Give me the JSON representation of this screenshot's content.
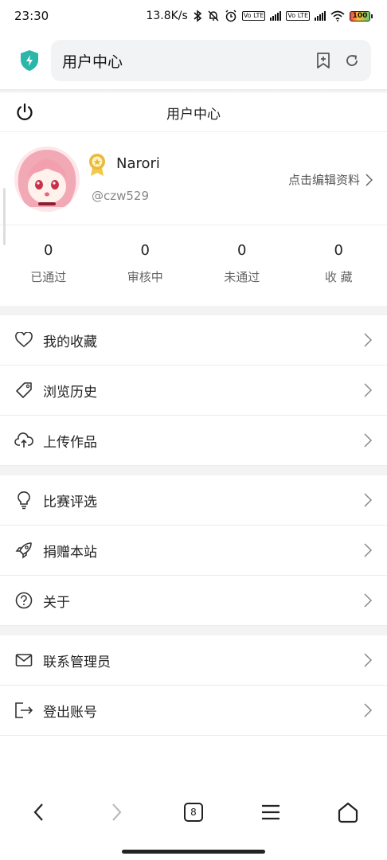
{
  "status_bar": {
    "time": "23:30",
    "network_speed": "13.8K/s",
    "volte1": "Vo LTE",
    "volte2": "Vo LTE",
    "battery": "100"
  },
  "browser": {
    "url_text": "用户中心",
    "tab_count": "8"
  },
  "header": {
    "title": "用户中心"
  },
  "profile": {
    "username": "Narori",
    "handle": "@czw529",
    "edit_label": "点击编辑资料"
  },
  "stats": [
    {
      "value": "0",
      "label": "已通过"
    },
    {
      "value": "0",
      "label": "审核中"
    },
    {
      "value": "0",
      "label": "未通过"
    },
    {
      "value": "0",
      "label": "收 藏"
    }
  ],
  "menu_groups": [
    [
      {
        "label": "我的收藏",
        "icon": "heart-icon"
      },
      {
        "label": "浏览历史",
        "icon": "tag-icon"
      },
      {
        "label": "上传作品",
        "icon": "cloud-upload-icon"
      }
    ],
    [
      {
        "label": "比赛评选",
        "icon": "lightbulb-icon"
      },
      {
        "label": "捐赠本站",
        "icon": "rocket-icon"
      },
      {
        "label": "关于",
        "icon": "question-circle-icon"
      }
    ],
    [
      {
        "label": "联系管理员",
        "icon": "mail-icon"
      },
      {
        "label": "登出账号",
        "icon": "logout-icon"
      }
    ]
  ],
  "colors": {
    "shield": "#2ab7a9",
    "medal": "#e9b93a",
    "divider": "#ececec",
    "section_gap": "#f3f3f3"
  }
}
